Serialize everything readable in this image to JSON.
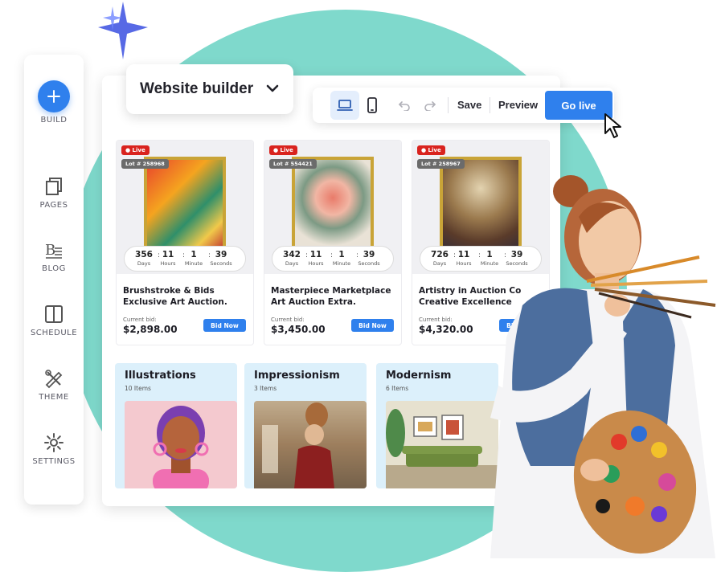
{
  "sidebar": {
    "items": [
      {
        "label": "BUILD",
        "icon": "plus-icon"
      },
      {
        "label": "PAGES",
        "icon": "pages-icon"
      },
      {
        "label": "BLOG",
        "icon": "blog-icon"
      },
      {
        "label": "SCHEDULE",
        "icon": "book-icon"
      },
      {
        "label": "THEME",
        "icon": "brush-ruler-icon"
      },
      {
        "label": "SETTINGS",
        "icon": "gear-icon"
      }
    ]
  },
  "header": {
    "dropdown_label": "Website builder",
    "save_label": "Save",
    "preview_label": "Preview",
    "golive_label": "Go live"
  },
  "cards": [
    {
      "live": "Live",
      "lot": "Lot # 258968",
      "timer": {
        "days": "356",
        "hours": "11",
        "minute": "1",
        "seconds": "39"
      },
      "title": "Brushstroke & Bids Exclusive Art Auction.",
      "bid_label": "Current bid:",
      "bid_value": "$2,898.00",
      "button": "Bid Now"
    },
    {
      "live": "Live",
      "lot": "Lot # 554421",
      "timer": {
        "days": "342",
        "hours": "11",
        "minute": "1",
        "seconds": "39"
      },
      "title": "Masterpiece Marketplace Art Auction Extra.",
      "bid_label": "Current bid:",
      "bid_value": "$3,450.00",
      "button": "Bid Now"
    },
    {
      "live": "Live",
      "lot": "Lot # 258967",
      "timer": {
        "days": "726",
        "hours": "11",
        "minute": "1",
        "seconds": "39"
      },
      "title": "Artistry in Auction Co Creative Excellence",
      "bid_label": "Current bid:",
      "bid_value": "$4,320.00",
      "button": "Bid Now"
    }
  ],
  "timer_units": {
    "days": "Days",
    "hours": "Hours",
    "minute": "Minute",
    "seconds": "Seconds"
  },
  "categories": [
    {
      "title": "Illustrations",
      "count": "10 Items"
    },
    {
      "title": "Impressionism",
      "count": "3 Items"
    },
    {
      "title": "Modernism",
      "count": "6 Items"
    }
  ],
  "colors": {
    "accent": "#2f80ed",
    "live": "#d9231e",
    "teal": "#7fd9cc",
    "category_bg": "#dcf0fb"
  }
}
